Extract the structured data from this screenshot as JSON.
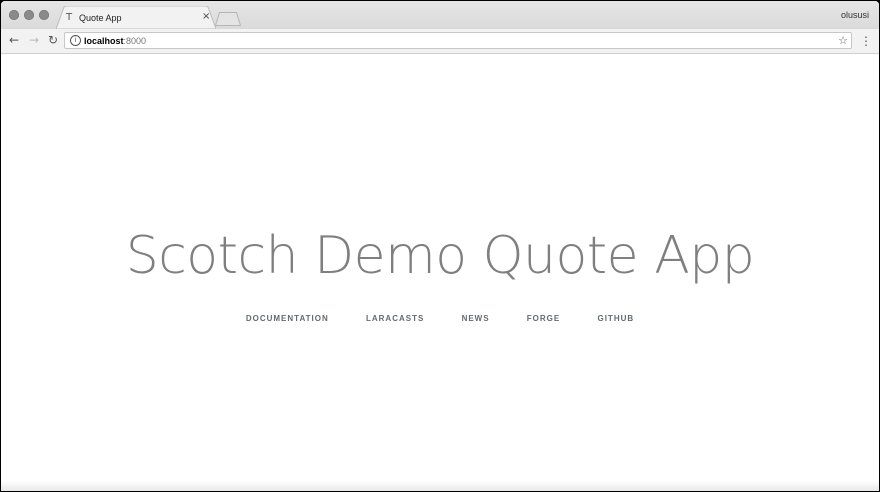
{
  "browser": {
    "tab": {
      "favicon": "T",
      "title": "Quote App",
      "close_glyph": "×"
    },
    "profile_name": "olususi",
    "toolbar": {
      "back_glyph": "←",
      "forward_glyph": "→",
      "reload_glyph": "↻",
      "url_host": "localhost",
      "url_port": ":8000",
      "info_glyph": "i",
      "star_glyph": "☆",
      "menu_glyph": "⋮"
    }
  },
  "page": {
    "title": "Scotch Demo Quote App",
    "links": [
      "DOCUMENTATION",
      "LARACASTS",
      "NEWS",
      "FORGE",
      "GITHUB"
    ]
  },
  "colors": {
    "title_text": "#7d7f80",
    "link_text": "#636b6f",
    "tabstrip": "#dadada",
    "toolbar": "#f2f2f2"
  },
  "icons": {
    "window_controls": [
      "close-dot-icon",
      "minimize-dot-icon",
      "maximize-dot-icon"
    ],
    "tab_favicon": "favicon-icon",
    "new_tab": "new-tab-icon",
    "info": "info-icon",
    "bookmark": "star-icon",
    "menu": "kebab-menu-icon"
  }
}
